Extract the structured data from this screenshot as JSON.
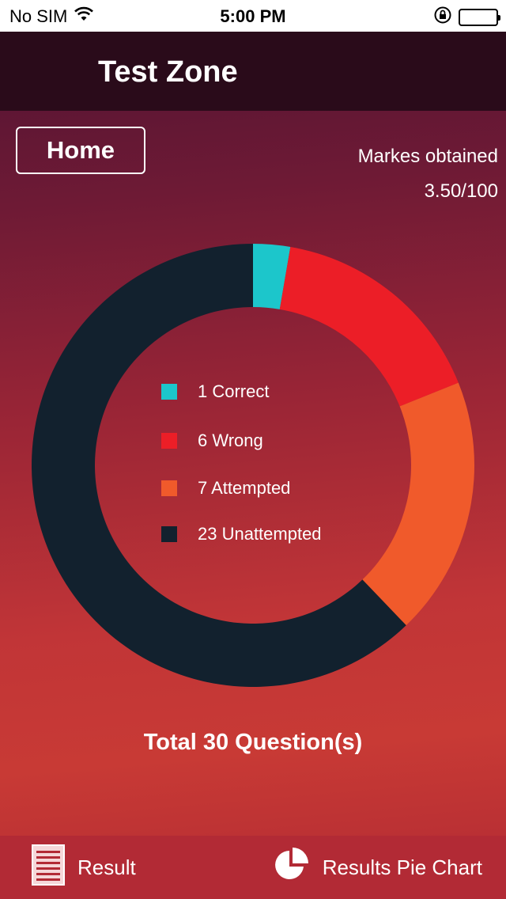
{
  "status_bar": {
    "carrier": "No SIM",
    "time": "5:00 PM",
    "icons": [
      "wifi-icon",
      "orientation-lock-icon",
      "battery-icon"
    ]
  },
  "nav": {
    "title": "Test Zone"
  },
  "header": {
    "home_label": "Home",
    "marks_label": "Markes obtained",
    "marks_value": "3.50/100"
  },
  "chart_data": {
    "type": "pie",
    "categories": [
      "Correct",
      "Wrong",
      "Attempted",
      "Unattempted"
    ],
    "values": [
      1,
      6,
      7,
      23
    ],
    "colors": [
      "#1cc6cb",
      "#ec1e27",
      "#f05a2b",
      "#12212e"
    ],
    "legend_labels": [
      "1 Correct",
      "6 Wrong",
      "7 Attempted",
      "23 Unattempted"
    ],
    "donut": true,
    "legend_placement": "center"
  },
  "summary": {
    "total_text": "Total 30 Question(s)"
  },
  "tab_bar": {
    "result_label": "Result",
    "pie_chart_label": "Results Pie Chart",
    "result_icon": "document-list-icon",
    "pie_icon": "pie-chart-icon"
  }
}
